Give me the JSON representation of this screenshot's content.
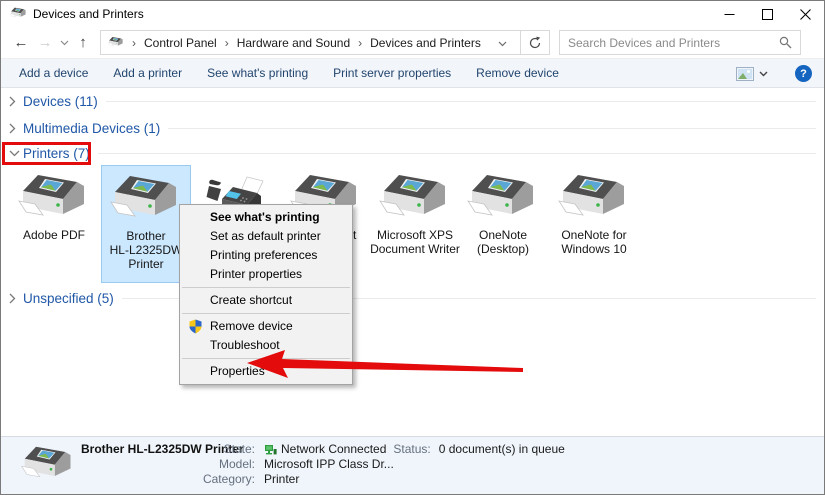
{
  "window": {
    "title": "Devices and Printers"
  },
  "navbar": {
    "breadcrumb": [
      "Control Panel",
      "Hardware and Sound",
      "Devices and Printers"
    ],
    "search_placeholder": "Search Devices and Printers"
  },
  "toolbar": {
    "items": [
      "Add a device",
      "Add a printer",
      "See what's printing",
      "Print server properties",
      "Remove device"
    ]
  },
  "groups": [
    {
      "label": "Devices (11)",
      "expanded": false,
      "highlighted": false
    },
    {
      "label": "Multimedia Devices (1)",
      "expanded": false,
      "highlighted": false
    },
    {
      "label": "Printers (7)",
      "expanded": true,
      "highlighted": true
    },
    {
      "label": "Unspecified (5)",
      "expanded": false,
      "highlighted": false
    }
  ],
  "printers": [
    {
      "name": "adobe-pdf",
      "label": "Adobe PDF",
      "icon": "printer",
      "selected": false
    },
    {
      "name": "brother-hl-l2325dw",
      "label": "Brother\nHL-L2325DW\nPrinter",
      "icon": "printer",
      "selected": true
    },
    {
      "name": "fax",
      "label": "",
      "icon": "fax",
      "selected": false
    },
    {
      "name": "occluded-printer",
      "label": "t",
      "icon": "printer",
      "selected": false,
      "label_partially_hidden": true
    },
    {
      "name": "microsoft-xps",
      "label": "Microsoft XPS\nDocument Writer",
      "icon": "printer",
      "selected": false
    },
    {
      "name": "onenote-desktop",
      "label": "OneNote\n(Desktop)",
      "icon": "printer",
      "selected": false
    },
    {
      "name": "onenote-windows10",
      "label": "OneNote for\nWindows 10",
      "icon": "printer",
      "selected": false
    }
  ],
  "context_menu": {
    "items": [
      {
        "label": "See what's printing",
        "bold": true
      },
      {
        "label": "Set as default printer"
      },
      {
        "label": "Printing preferences"
      },
      {
        "label": "Printer properties"
      },
      {
        "separator": true
      },
      {
        "label": "Create shortcut"
      },
      {
        "separator": true
      },
      {
        "label": "Remove device",
        "icon": "uac-shield"
      },
      {
        "label": "Troubleshoot"
      },
      {
        "separator": true
      },
      {
        "label": "Properties"
      }
    ]
  },
  "annotations": {
    "color": "#e30b0b",
    "box_around": "Printers (7)",
    "arrow_points_to": "Properties"
  },
  "status_bar": {
    "device_name": "Brother HL-L2325DW Printer",
    "state_label": "State:",
    "state_value": "Network Connected",
    "status_label": "Status:",
    "status_value": "0 document(s) in queue",
    "model_label": "Model:",
    "model_value": "Microsoft IPP Class Dr...",
    "category_label": "Category:",
    "category_value": "Printer"
  },
  "icons": {
    "app": "printer-icon",
    "back": "arrow-left-icon",
    "forward": "arrow-right-icon",
    "up": "arrow-up-icon",
    "refresh": "refresh-icon",
    "search": "magnifier-icon",
    "view_mode": "view-mode-icon",
    "help": "help-icon",
    "remove_device": "uac-shield-icon",
    "network_state": "network-icon"
  }
}
